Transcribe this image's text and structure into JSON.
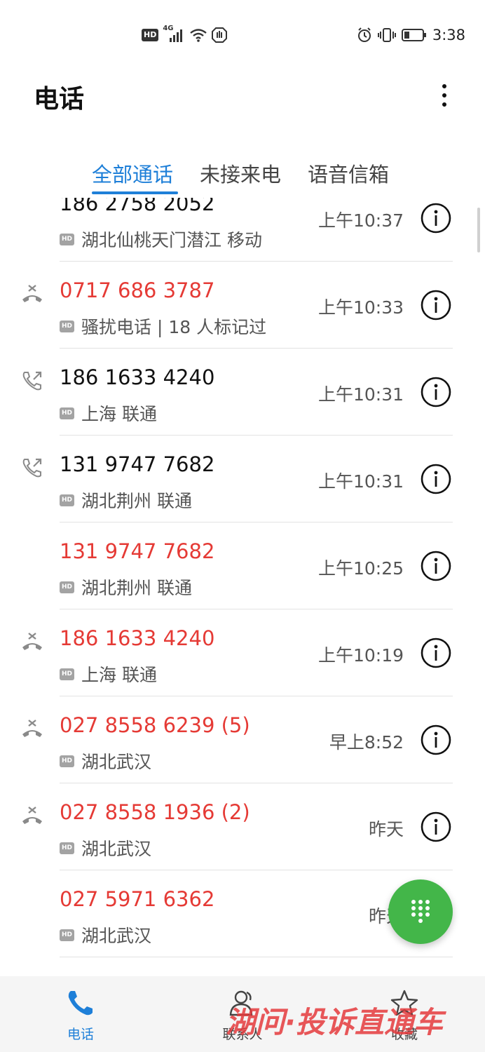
{
  "status_bar": {
    "network_label": "HD",
    "signal_label": "4G",
    "time": "3:38"
  },
  "app": {
    "title": "电话"
  },
  "tabs": [
    {
      "label": "全部通话",
      "active": true
    },
    {
      "label": "未接来电",
      "active": false
    },
    {
      "label": "语音信箱",
      "active": false
    }
  ],
  "calls": [
    {
      "number": "186 2758 2052",
      "location": "湖北仙桃天门潜江 移动",
      "time": "上午10:37",
      "missed": false,
      "type": "none",
      "hd": "HD"
    },
    {
      "number": "0717 686 3787",
      "location": "骚扰电话 | 18 人标记过",
      "time": "上午10:33",
      "missed": true,
      "type": "rejected",
      "hd": "HD"
    },
    {
      "number": "186 1633 4240",
      "location": "上海 联通",
      "time": "上午10:31",
      "missed": false,
      "type": "outgoing",
      "hd": "HD"
    },
    {
      "number": "131 9747 7682",
      "location": "湖北荆州 联通",
      "time": "上午10:31",
      "missed": false,
      "type": "outgoing",
      "hd": "HD"
    },
    {
      "number": "131 9747 7682",
      "location": "湖北荆州 联通",
      "time": "上午10:25",
      "missed": true,
      "type": "none",
      "hd": "HD"
    },
    {
      "number": "186 1633 4240",
      "location": "上海 联通",
      "time": "上午10:19",
      "missed": true,
      "type": "rejected",
      "hd": "HD"
    },
    {
      "number": "027 8558 6239 (5)",
      "location": "湖北武汉",
      "time": "早上8:52",
      "missed": true,
      "type": "rejected",
      "hd": "HD"
    },
    {
      "number": "027 8558 1936 (2)",
      "location": "湖北武汉",
      "time": "昨天",
      "missed": true,
      "type": "rejected",
      "hd": "HD"
    },
    {
      "number": "027 5971 6362",
      "location": "湖北武汉",
      "time": "昨天",
      "missed": true,
      "type": "none",
      "hd": "HD"
    }
  ],
  "bottom_nav": [
    {
      "label": "电话",
      "icon": "phone-icon",
      "active": true
    },
    {
      "label": "联系人",
      "icon": "contacts-icon",
      "active": false
    },
    {
      "label": "收藏",
      "icon": "star-icon",
      "active": false
    }
  ],
  "watermark": {
    "text": "湖问·投诉直通车"
  },
  "colors": {
    "accent": "#1e7fd8",
    "missed": "#e53a35",
    "fab": "#43b649",
    "watermark": "#e4393c"
  }
}
